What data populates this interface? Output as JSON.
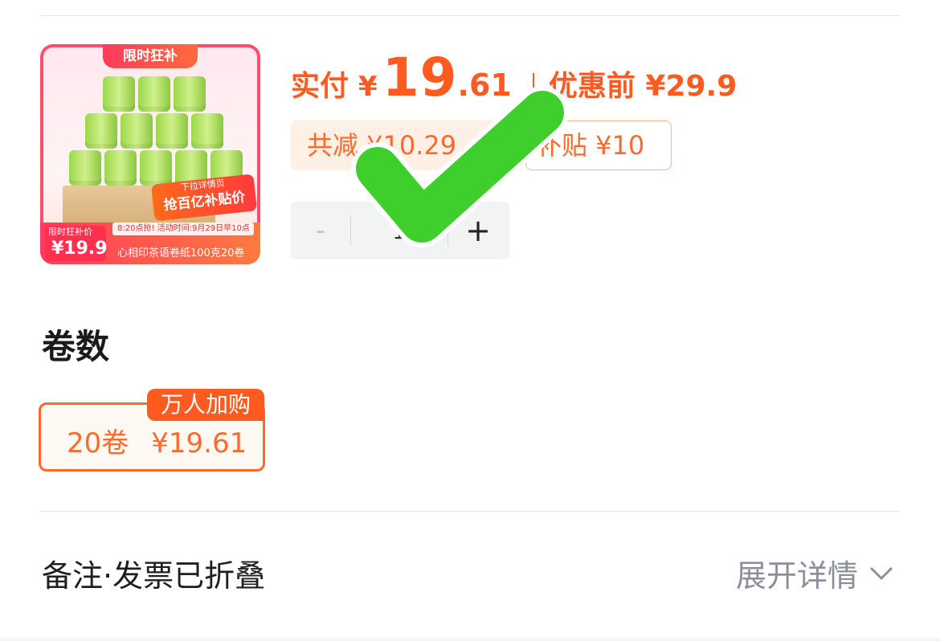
{
  "product": {
    "image": {
      "banner": "限时狂补",
      "promo_small": "下拉详情页",
      "promo_big": "抢百亿补贴价",
      "notice": "8:20点抢! 活动时间:9月29日早10点",
      "price_label": "限时狂补价",
      "price_value": "¥19.9",
      "title": "心相印茶语卷纸100克20卷"
    },
    "pay_label": "实付",
    "currency": "¥",
    "price_int": "19",
    "price_dec": ".61",
    "original_price_label": "优惠前 ¥29.9",
    "discount_total": "共减 ¥10.29",
    "subsidy": "补贴 ¥10",
    "quantity": {
      "minus": "-",
      "value": "1",
      "plus": "+"
    }
  },
  "spec": {
    "title": "卷数",
    "options": [
      {
        "label": "20卷",
        "price": "¥19.61",
        "badge": "万人加购",
        "selected": true
      }
    ]
  },
  "notes": {
    "title": "备注·发票已折叠",
    "expand_label": "展开详情"
  },
  "colors": {
    "accent": "#ff5a1f",
    "check": "#3ecf2c"
  },
  "icons": {
    "overlay": "checkmark-icon",
    "expand": "chevron-down-icon"
  }
}
